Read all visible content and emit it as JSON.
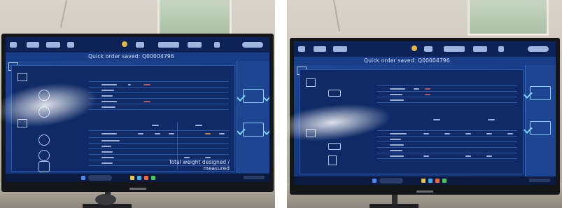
{
  "left_photo": {
    "title": "Quick order saved: Q00004796",
    "footer_line1": "Total weight designed /",
    "footer_line2": "measured"
  },
  "right_photo": {
    "title": "Quick order saved: Q00004796"
  },
  "colors": {
    "screen_blue": "#163b83",
    "toolbar": "#0d2357",
    "accent_cyan": "#7fd3ff",
    "warning": "#e0b94a"
  }
}
